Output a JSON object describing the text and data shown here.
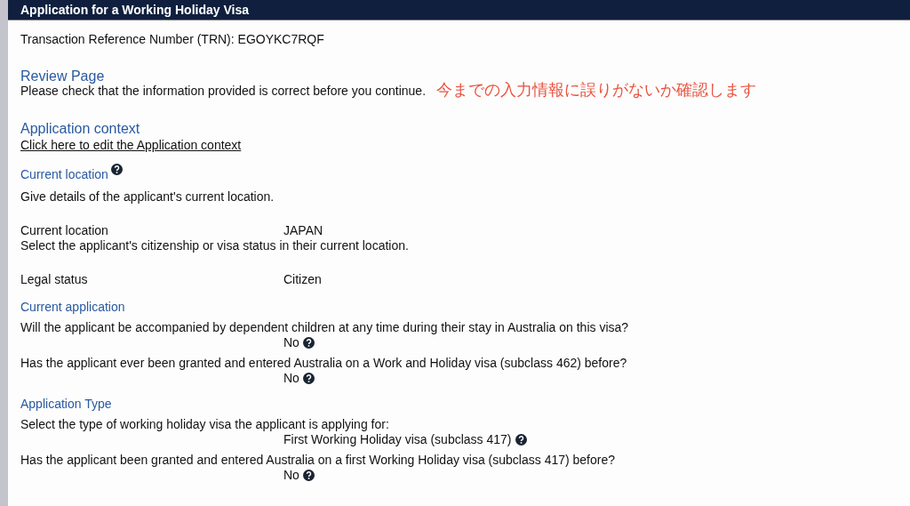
{
  "window": {
    "title": "Application for a Working Holiday Visa"
  },
  "blocks": [
    {
      "kind": "text",
      "text": "Transaction Reference Number (TRN): EGOYKC7RQF"
    },
    {
      "kind": "title",
      "text": "Review Page",
      "help": false
    },
    {
      "kind": "text",
      "text": "Please check that the information provided is correct before you continue.",
      "annotation": "今までの入力情報に誤りがないか確認します"
    },
    {
      "kind": "title",
      "text": "Application context",
      "help": false
    },
    {
      "kind": "link",
      "text": "Click here to edit the Application context"
    },
    {
      "kind": "heading",
      "text": "Current location",
      "help": true
    },
    {
      "kind": "text",
      "text": "Give details of the applicant's current location."
    },
    {
      "kind": "field",
      "label": "Current location",
      "value": "JAPAN"
    },
    {
      "kind": "text",
      "text": "Select the applicant's citizenship or visa status in their current location."
    },
    {
      "kind": "field",
      "label": "Legal status",
      "value": "Citizen"
    },
    {
      "kind": "heading",
      "text": "Current application",
      "help": false
    },
    {
      "kind": "question",
      "text": "Will the applicant be accompanied by dependent children at any time during their stay in Australia on this visa?",
      "answer": "No"
    },
    {
      "kind": "question",
      "text": "Has the applicant ever been granted and entered Australia on a Work and Holiday visa (subclass 462) before?",
      "answer": "No"
    },
    {
      "kind": "heading",
      "text": "Application Type",
      "help": false
    },
    {
      "kind": "question",
      "text": "Select the type of working holiday visa the applicant is applying for:",
      "answer": "First Working Holiday visa (subclass 417)"
    },
    {
      "kind": "question",
      "text": "Has the applicant been granted and entered Australia on a first Working Holiday visa (subclass 417) before?",
      "answer": "No"
    }
  ]
}
